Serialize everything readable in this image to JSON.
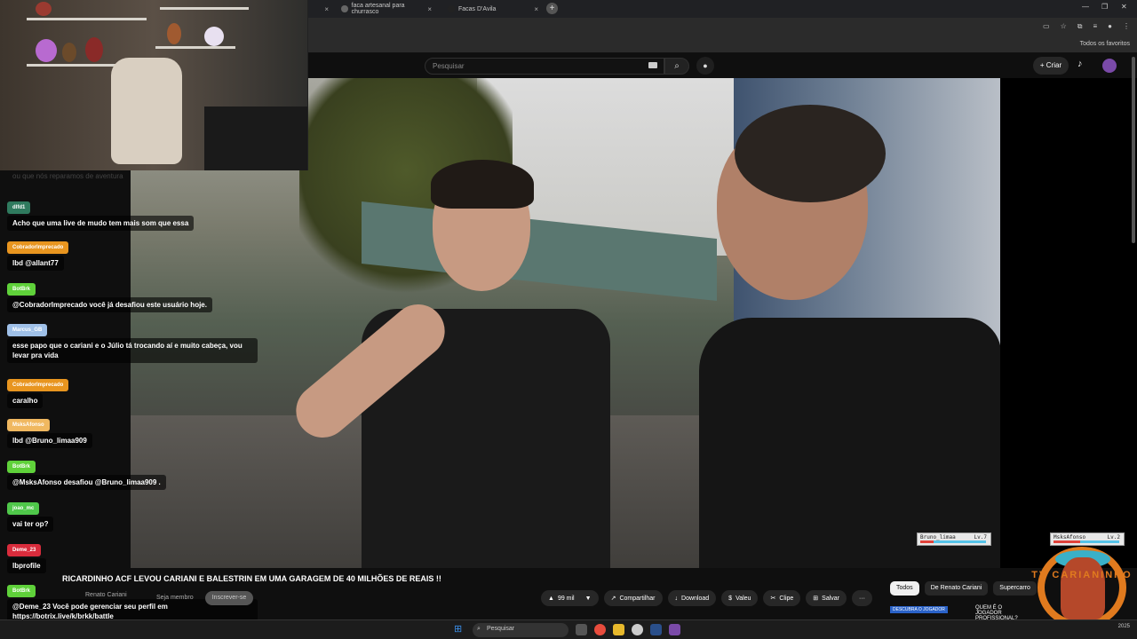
{
  "browser": {
    "tabs": [
      {
        "title": "",
        "close": "×"
      },
      {
        "title": "faca artesanal para churrasco",
        "close": "×"
      },
      {
        "title": "Facas D'Avila",
        "close": "×"
      }
    ],
    "new_tab": "+",
    "window_controls": [
      "—",
      "❐",
      "✕"
    ],
    "bookmarks_all": "Todos os favoritos"
  },
  "youtube": {
    "search_placeholder": "Pesquisar",
    "create_label": "Criar",
    "video_title": "RICARDINHO ACF LEVOU CARIANI E BALESTRIN EM UMA GARAGEM DE 40 MILHÕES DE REAIS !!",
    "channel_name": "Renato Cariani",
    "member_label": "Seja membro",
    "subscribe_label": "Inscrever-se",
    "actions": {
      "likes": "99 mil",
      "share": "Compartilhar",
      "download": "Download",
      "thanks": "Valeu",
      "clip": "Clipe",
      "save": "Salvar",
      "more": "···"
    },
    "chips": [
      "Todos",
      "De Renato Cariani",
      "Supercarro"
    ],
    "colors": {
      "bg": "#0f0f0f",
      "chip_active": "#f1f1f1"
    }
  },
  "chat": {
    "previous_line": "ou que nós reparamos de aventura",
    "messages": [
      {
        "user": "dlfd1",
        "color": "#2f7a5e",
        "text": "Acho que uma live de mudo tem mais som que essa"
      },
      {
        "user": "CobradorImprecado",
        "color": "#e8951f",
        "text": "lbd @allant77"
      },
      {
        "user": "BotBrk",
        "color": "#5fd13a",
        "text": "@CobradorImprecado você já desafiou este usuário hoje."
      },
      {
        "user": "Marcus_GB",
        "color": "#9fc0e8",
        "text": "esse papo que o cariani e o Júlio tá trocando aí e muito cabeça, vou levar pra vida"
      },
      {
        "user": "CobradorImprecado",
        "color": "#e8951f",
        "text": "caralho"
      },
      {
        "user": "MsksAfonso",
        "color": "#f0b860",
        "text": "lbd @Bruno_limaa909"
      },
      {
        "user": "BotBrk",
        "color": "#5fd13a",
        "text": "@MsksAfonso desafiou @Bruno_limaa909 ."
      },
      {
        "user": "joao_mc",
        "color": "#4fc74a",
        "text": "vai ter op?"
      },
      {
        "user": "Deme_23",
        "color": "#d92c3c",
        "text": "lbprofile"
      },
      {
        "user": "BotBrk",
        "color": "#5fd13a",
        "text": "@Deme_23 Você pode gerenciar seu perfil em https://botrix.live/k/brkk/battle"
      }
    ]
  },
  "game_hud": [
    {
      "name": "Bruno_limaa",
      "level": "Lv.7",
      "hp": "HP"
    },
    {
      "name": "MsksAfonso",
      "level": "Lv.2",
      "hp": "HP"
    }
  ],
  "overlay": {
    "logo_text": "TV CARIANINHO",
    "ticker_badge": "DESCUBRA O JOGADOR",
    "ticker_text": "QUEM É O JOGADOR PROFISSIONAL?"
  },
  "taskbar": {
    "search_placeholder": "Pesquisar",
    "clock": "",
    "date": "2025"
  },
  "icons": {
    "search": "⌕",
    "mic": "🎙",
    "bell": "🔔",
    "plus": "+",
    "like": "👍",
    "dislike": "👎",
    "share": "↗",
    "download": "⬇",
    "thanks": "$",
    "clip": "✂",
    "save": "⊞",
    "windows": "⊞"
  }
}
